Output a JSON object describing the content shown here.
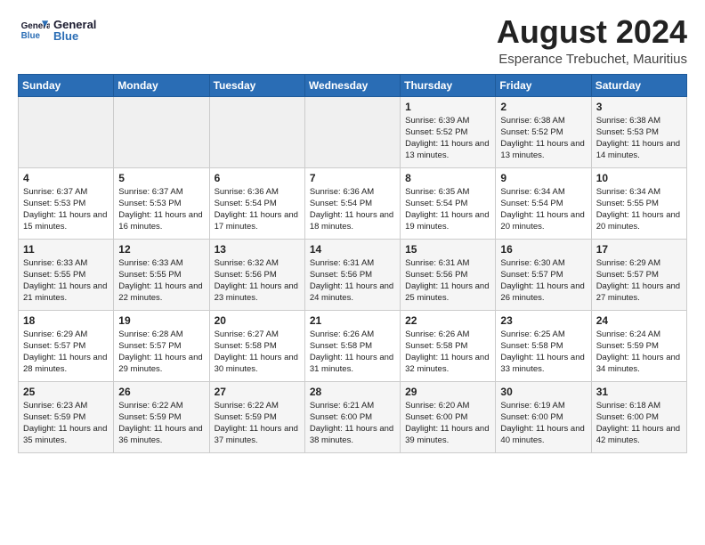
{
  "header": {
    "logo_line1": "General",
    "logo_line2": "Blue",
    "main_title": "August 2024",
    "subtitle": "Esperance Trebuchet, Mauritius"
  },
  "calendar": {
    "days_of_week": [
      "Sunday",
      "Monday",
      "Tuesday",
      "Wednesday",
      "Thursday",
      "Friday",
      "Saturday"
    ],
    "weeks": [
      [
        {
          "day": "",
          "info": ""
        },
        {
          "day": "",
          "info": ""
        },
        {
          "day": "",
          "info": ""
        },
        {
          "day": "",
          "info": ""
        },
        {
          "day": "1",
          "info": "Sunrise: 6:39 AM\nSunset: 5:52 PM\nDaylight: 11 hours and 13 minutes."
        },
        {
          "day": "2",
          "info": "Sunrise: 6:38 AM\nSunset: 5:52 PM\nDaylight: 11 hours and 13 minutes."
        },
        {
          "day": "3",
          "info": "Sunrise: 6:38 AM\nSunset: 5:53 PM\nDaylight: 11 hours and 14 minutes."
        }
      ],
      [
        {
          "day": "4",
          "info": "Sunrise: 6:37 AM\nSunset: 5:53 PM\nDaylight: 11 hours and 15 minutes."
        },
        {
          "day": "5",
          "info": "Sunrise: 6:37 AM\nSunset: 5:53 PM\nDaylight: 11 hours and 16 minutes."
        },
        {
          "day": "6",
          "info": "Sunrise: 6:36 AM\nSunset: 5:54 PM\nDaylight: 11 hours and 17 minutes."
        },
        {
          "day": "7",
          "info": "Sunrise: 6:36 AM\nSunset: 5:54 PM\nDaylight: 11 hours and 18 minutes."
        },
        {
          "day": "8",
          "info": "Sunrise: 6:35 AM\nSunset: 5:54 PM\nDaylight: 11 hours and 19 minutes."
        },
        {
          "day": "9",
          "info": "Sunrise: 6:34 AM\nSunset: 5:54 PM\nDaylight: 11 hours and 20 minutes."
        },
        {
          "day": "10",
          "info": "Sunrise: 6:34 AM\nSunset: 5:55 PM\nDaylight: 11 hours and 20 minutes."
        }
      ],
      [
        {
          "day": "11",
          "info": "Sunrise: 6:33 AM\nSunset: 5:55 PM\nDaylight: 11 hours and 21 minutes."
        },
        {
          "day": "12",
          "info": "Sunrise: 6:33 AM\nSunset: 5:55 PM\nDaylight: 11 hours and 22 minutes."
        },
        {
          "day": "13",
          "info": "Sunrise: 6:32 AM\nSunset: 5:56 PM\nDaylight: 11 hours and 23 minutes."
        },
        {
          "day": "14",
          "info": "Sunrise: 6:31 AM\nSunset: 5:56 PM\nDaylight: 11 hours and 24 minutes."
        },
        {
          "day": "15",
          "info": "Sunrise: 6:31 AM\nSunset: 5:56 PM\nDaylight: 11 hours and 25 minutes."
        },
        {
          "day": "16",
          "info": "Sunrise: 6:30 AM\nSunset: 5:57 PM\nDaylight: 11 hours and 26 minutes."
        },
        {
          "day": "17",
          "info": "Sunrise: 6:29 AM\nSunset: 5:57 PM\nDaylight: 11 hours and 27 minutes."
        }
      ],
      [
        {
          "day": "18",
          "info": "Sunrise: 6:29 AM\nSunset: 5:57 PM\nDaylight: 11 hours and 28 minutes."
        },
        {
          "day": "19",
          "info": "Sunrise: 6:28 AM\nSunset: 5:57 PM\nDaylight: 11 hours and 29 minutes."
        },
        {
          "day": "20",
          "info": "Sunrise: 6:27 AM\nSunset: 5:58 PM\nDaylight: 11 hours and 30 minutes."
        },
        {
          "day": "21",
          "info": "Sunrise: 6:26 AM\nSunset: 5:58 PM\nDaylight: 11 hours and 31 minutes."
        },
        {
          "day": "22",
          "info": "Sunrise: 6:26 AM\nSunset: 5:58 PM\nDaylight: 11 hours and 32 minutes."
        },
        {
          "day": "23",
          "info": "Sunrise: 6:25 AM\nSunset: 5:58 PM\nDaylight: 11 hours and 33 minutes."
        },
        {
          "day": "24",
          "info": "Sunrise: 6:24 AM\nSunset: 5:59 PM\nDaylight: 11 hours and 34 minutes."
        }
      ],
      [
        {
          "day": "25",
          "info": "Sunrise: 6:23 AM\nSunset: 5:59 PM\nDaylight: 11 hours and 35 minutes."
        },
        {
          "day": "26",
          "info": "Sunrise: 6:22 AM\nSunset: 5:59 PM\nDaylight: 11 hours and 36 minutes."
        },
        {
          "day": "27",
          "info": "Sunrise: 6:22 AM\nSunset: 5:59 PM\nDaylight: 11 hours and 37 minutes."
        },
        {
          "day": "28",
          "info": "Sunrise: 6:21 AM\nSunset: 6:00 PM\nDaylight: 11 hours and 38 minutes."
        },
        {
          "day": "29",
          "info": "Sunrise: 6:20 AM\nSunset: 6:00 PM\nDaylight: 11 hours and 39 minutes."
        },
        {
          "day": "30",
          "info": "Sunrise: 6:19 AM\nSunset: 6:00 PM\nDaylight: 11 hours and 40 minutes."
        },
        {
          "day": "31",
          "info": "Sunrise: 6:18 AM\nSunset: 6:00 PM\nDaylight: 11 hours and 42 minutes."
        }
      ]
    ]
  }
}
